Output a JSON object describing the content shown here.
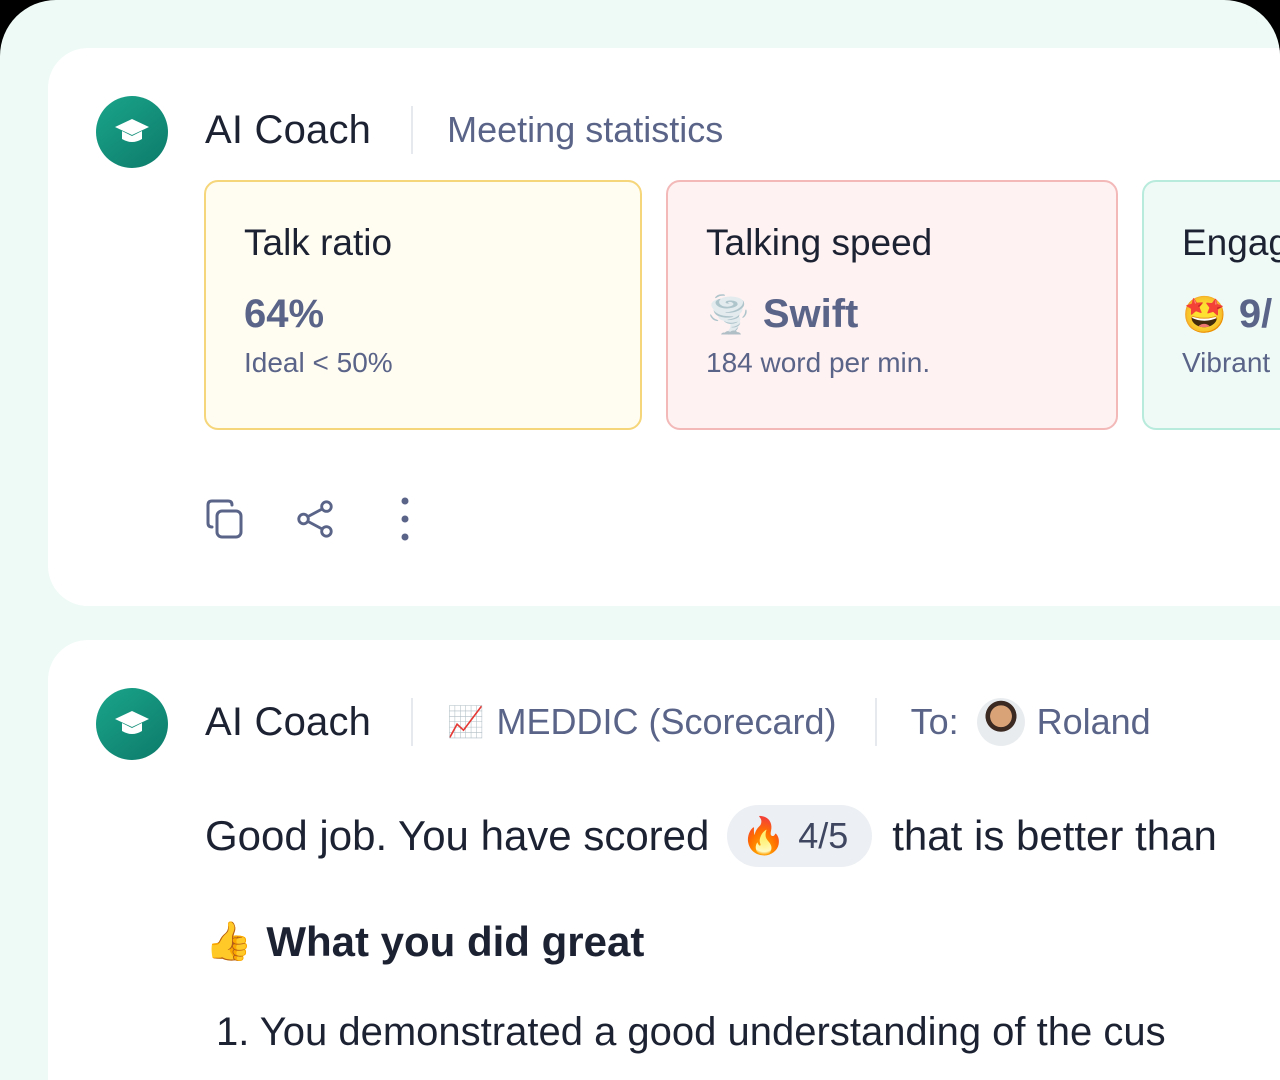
{
  "card_stats": {
    "coach_name": "AI Coach",
    "subtitle": "Meeting statistics",
    "stats": [
      {
        "title": "Talk ratio",
        "value": "64%",
        "emoji": "",
        "sub": "Ideal < 50%"
      },
      {
        "title": "Talking speed",
        "value": "Swift",
        "emoji": "🌪️",
        "sub": "184 word per min."
      },
      {
        "title": "Engag",
        "value": "9/",
        "emoji": "🤩",
        "sub": "Vibrant"
      }
    ],
    "actions": [
      "copy-icon",
      "share-icon",
      "more-vertical-icon"
    ]
  },
  "card_feedback": {
    "coach_name": "AI Coach",
    "scorecard_emoji": "📈",
    "scorecard_label": "MEDDIC (Scorecard)",
    "to_label": "To:",
    "recipient": "Roland",
    "score_prefix": "Good job. You have scored",
    "score_emoji": "🔥",
    "score_value": "4/5",
    "score_suffix": "that is better than",
    "section_emoji": "👍",
    "section_title": "What you did great",
    "list_item": "1. You demonstrated a good understanding of the cus"
  },
  "colors": {
    "accent": "#13947d",
    "text_dark": "#1d2233",
    "text_muted": "#5a6488",
    "talk_ratio_border": "#f6d67a",
    "talking_speed_border": "#f3b9b9",
    "engagement_border": "#b8ebdc"
  }
}
